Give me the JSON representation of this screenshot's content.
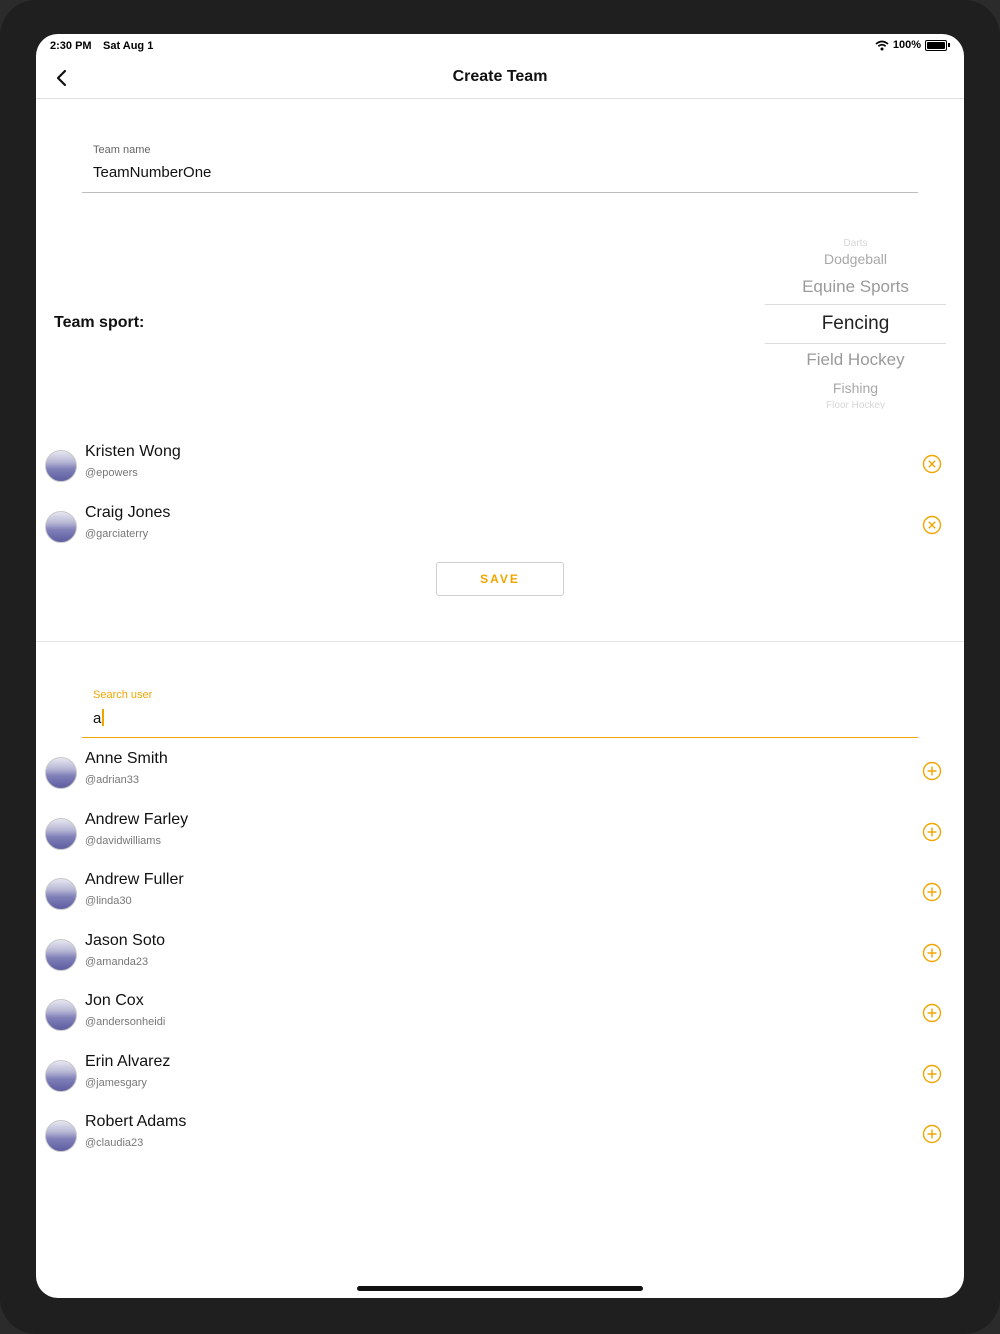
{
  "status_bar": {
    "time": "2:30 PM",
    "date": "Sat Aug 1",
    "battery": "100%"
  },
  "nav": {
    "title": "Create Team"
  },
  "team_name": {
    "label": "Team name",
    "value": "TeamNumberOne"
  },
  "sport": {
    "label": "Team sport:",
    "options_visible": [
      "Darts",
      "Dodgeball",
      "Equine Sports",
      "Fencing",
      "Field Hockey",
      "Fishing",
      "Floor Hockey"
    ],
    "selected": "Fencing"
  },
  "team_members": [
    {
      "name": "Kristen Wong",
      "handle": "@epowers"
    },
    {
      "name": "Craig Jones",
      "handle": "@garciaterry"
    }
  ],
  "save_label": "SAVE",
  "search": {
    "label": "Search user",
    "value": "a"
  },
  "search_results": [
    {
      "name": "Anne Smith",
      "handle": "@adrian33"
    },
    {
      "name": "Andrew Farley",
      "handle": "@davidwilliams"
    },
    {
      "name": "Andrew Fuller",
      "handle": "@linda30"
    },
    {
      "name": "Jason Soto",
      "handle": "@amanda23"
    },
    {
      "name": "Jon Cox",
      "handle": "@andersonheidi"
    },
    {
      "name": "Erin Alvarez",
      "handle": "@jamesgary"
    },
    {
      "name": "Robert Adams",
      "handle": "@claudia23"
    }
  ],
  "colors": {
    "accent": "#f0a500",
    "text": "#111111",
    "muted": "#777777"
  },
  "icons": {
    "back": "chevron-left-icon",
    "remove": "remove-circle-icon",
    "add": "add-circle-icon",
    "wifi": "wifi-icon",
    "battery": "battery-icon"
  }
}
